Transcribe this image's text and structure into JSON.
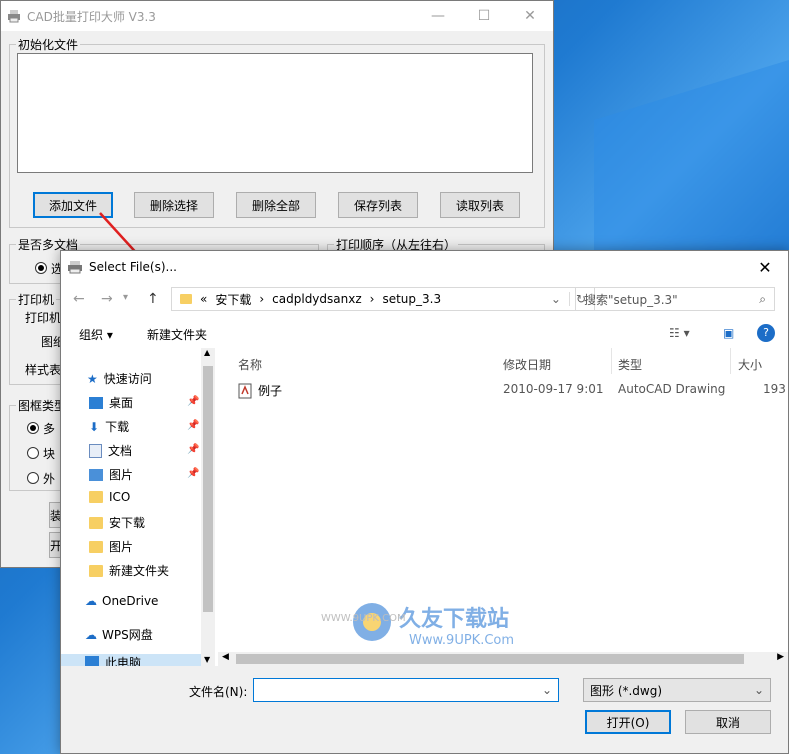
{
  "desktop": {
    "accent": "#1f7ad1"
  },
  "main_window": {
    "title": "CAD批量打印大师 V3.3",
    "window_buttons": {
      "minimize": "—",
      "maximize": "☐",
      "close": "✕"
    },
    "init_group": "初始化文件",
    "buttons": [
      "添加文件",
      "删除选择",
      "删除全部",
      "保存列表",
      "读取列表"
    ],
    "multi_doc_group": "是否多文档",
    "multi_doc_option": "选",
    "print_order_group": "打印顺序（从左往右）",
    "printer_group": "打印机",
    "printer_label": "打印机",
    "paper_label": "图纸",
    "style_label": "样式表",
    "frame_group": "图框类型",
    "frame_options": [
      "多",
      "块",
      "外"
    ],
    "left_btn_a": "装",
    "left_btn_b": "开"
  },
  "dialog": {
    "title": "Select File(s)...",
    "close": "✕",
    "breadcrumb": [
      "«",
      "安下载",
      "›",
      "cadpldydsanxz",
      "›",
      "setup_3.3"
    ],
    "search_placeholder": "搜索\"setup_3.3\"",
    "organize": "组织 ▾",
    "new_folder": "新建文件夹",
    "nav": {
      "quick_access": "快速访问",
      "items": [
        "桌面",
        "下载",
        "文档",
        "图片",
        "ICO",
        "安下载",
        "图片",
        "新建文件夹"
      ],
      "onedrive": "OneDrive",
      "wps": "WPS网盘",
      "this_pc": "此电脑"
    },
    "columns": [
      "名称",
      "修改日期",
      "类型",
      "大小"
    ],
    "files": [
      {
        "name": "例子",
        "date": "2010-09-17 9:01",
        "type": "AutoCAD Drawing",
        "size": "193"
      }
    ],
    "filename_label": "文件名(N):",
    "filename_value": "",
    "filetype": "图形 (*.dwg)",
    "open_button": "打开(O)",
    "cancel_button": "取消"
  },
  "watermark": {
    "brand": "久友下载站",
    "url1": "WWW.9UPK.COM",
    "url2": "Www.9UPK.Com"
  }
}
